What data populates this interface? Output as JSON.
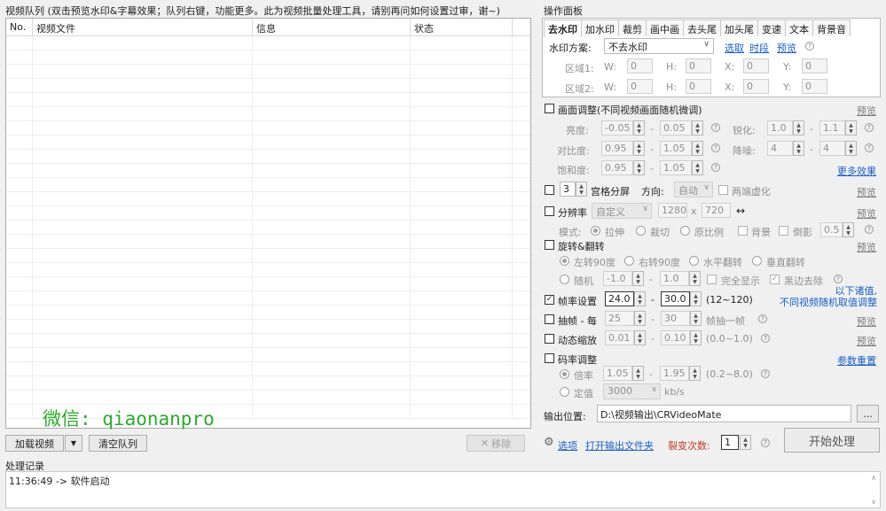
{
  "queue": {
    "title": "视频队列 (双击预览水印&字幕效果；队列右键，功能更多。此为视频批量处理工具，请别再问如何设置过审，谢~)",
    "columns": [
      "No.",
      "视频文件",
      "信息",
      "状态"
    ],
    "add_video": "加载视频",
    "clear": "清空队列",
    "remove": "移除",
    "watermark_text": "微信: qiaonanpro"
  },
  "log": {
    "title": "处理记录",
    "entry": "11:36:49 -> 软件启动"
  },
  "panel": {
    "title": "操作面板",
    "tabs": [
      "去水印",
      "加水印",
      "裁剪",
      "画中画",
      "去头尾",
      "加头尾",
      "变速",
      "文本",
      "背景音"
    ],
    "active_tab": 0,
    "watermark": {
      "scheme_label": "水印方案:",
      "scheme_value": "不去水印",
      "pick": "选取",
      "period": "时段",
      "preview": "预览",
      "region1": "区域1:",
      "region2": "区域2:",
      "w": "W:",
      "h": "H:",
      "x": "X:",
      "y": "Y:",
      "zero": "0"
    },
    "adjust": {
      "label": "画面调整(不同视频画面随机微调)",
      "preview": "预览",
      "brightness": "亮度:",
      "b1": "-0.05",
      "b2": "0.05",
      "sharpen": "锐化:",
      "s1": "1.0",
      "s2": "1.1",
      "contrast": "对比度:",
      "c1": "0.95",
      "c2": "1.05",
      "denoise": "降噪:",
      "d1": "4",
      "d2": "4",
      "saturation": "饱和度:",
      "sa1": "0.95",
      "sa2": "1.05",
      "more": "更多效果",
      "dash": "-"
    },
    "grid": {
      "value": "3",
      "label": "宫格分屏",
      "dir_label": "方向:",
      "dir_value": "自动",
      "blur": "两端虚化",
      "preview": "预览"
    },
    "resolution": {
      "label": "分辨率",
      "mode_value": "自定义",
      "width": "1280",
      "x": "x",
      "height": "720",
      "swap": "↔",
      "preview": "预览",
      "mode_label": "模式:",
      "stretch": "拉伸",
      "crop": "裁切",
      "original": "原比例",
      "background": "背景",
      "reflection": "倒影",
      "reflection_value": "0.5"
    },
    "rotate": {
      "label": "旋转&翻转",
      "preview": "预览",
      "left90": "左转90度",
      "right90": "右转90度",
      "hflip": "水平翻转",
      "vflip": "垂直翻转",
      "random": "随机",
      "r1": "-1.0",
      "r2": "1.0",
      "full": "完全显示",
      "black": "黑边去除"
    },
    "note": {
      "line1": "以下诸值,",
      "line2": "不同视频随机取值调整"
    },
    "fps": {
      "label": "帧率设置",
      "v1": "24.0",
      "v2": "30.0",
      "range": "(12~120)"
    },
    "drop": {
      "label": "抽帧 - 每",
      "v1": "25",
      "v2": "30",
      "tail": "帧抽一帧",
      "preview": "预览"
    },
    "zoom": {
      "label": "动态缩放",
      "v1": "0.01",
      "v2": "0.10",
      "range": "(0.0~1.0)",
      "preview": "预览"
    },
    "bitrate": {
      "label": "码率调整",
      "reset": "参数重置",
      "ratio": "倍率",
      "r1": "1.05",
      "r2": "1.95",
      "range": "(0.2~8.0)",
      "fixed": "定值",
      "fixed_value": "3000",
      "unit": "kb/s"
    },
    "output": {
      "label": "输出位置:",
      "path": "D:\\视频输出\\CRVideoMate",
      "browse": "..."
    },
    "footer": {
      "options": "选项",
      "open_folder": "打开输出文件夹",
      "split_label": "裂变次数:",
      "split_value": "1",
      "start": "开始处理"
    }
  }
}
